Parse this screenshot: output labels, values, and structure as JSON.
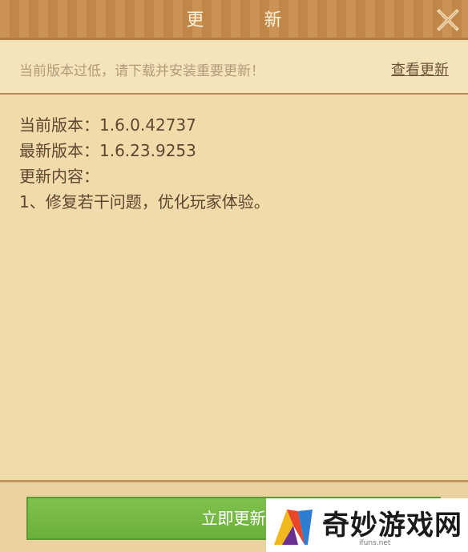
{
  "dialog": {
    "title": "更 新",
    "close_icon": "close-x-icon"
  },
  "notice": {
    "text": "当前版本过低，请下载并安装重要更新！",
    "link_label": "查看更新"
  },
  "content": {
    "current_version": "当前版本：1.6.0.42737",
    "latest_version": "最新版本：1.6.23.9253",
    "changelog_heading": "更新内容：",
    "changelog_item": "1、修复若干问题，优化玩家体验。"
  },
  "footer": {
    "button_label": "立即更新"
  },
  "watermark": {
    "text": "奇妙游戏网",
    "sub": "ifuns.net"
  },
  "colors": {
    "titlebar": "#c88c4c",
    "panel": "#efdcaa",
    "button": "#74b843",
    "text": "#5e4630"
  }
}
